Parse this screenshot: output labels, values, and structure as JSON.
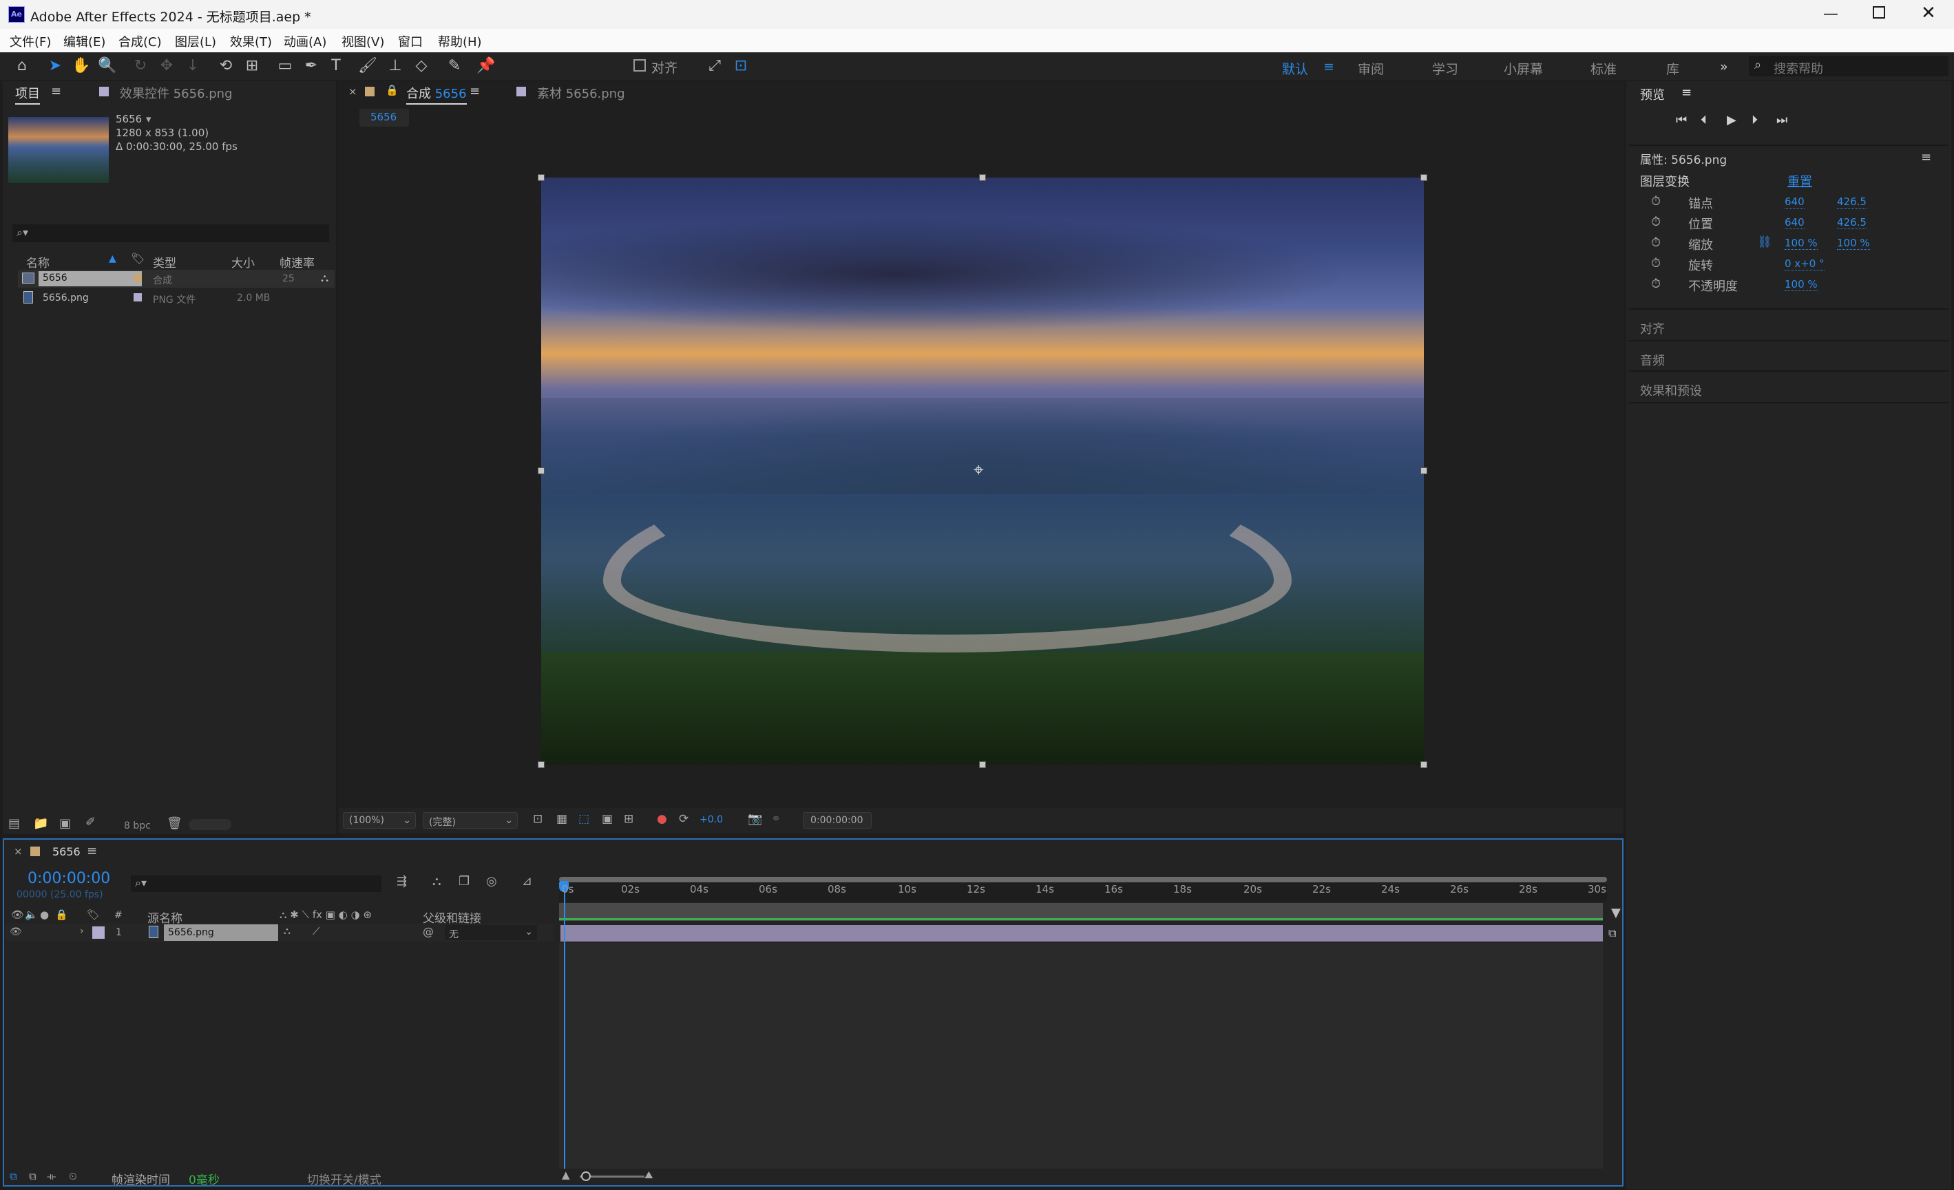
{
  "window": {
    "title": "Adobe After Effects 2024 - 无标题项目.aep *",
    "app_icon": "Ae"
  },
  "menu": [
    "文件(F)",
    "编辑(E)",
    "合成(C)",
    "图层(L)",
    "效果(T)",
    "动画(A)",
    "视图(V)",
    "窗口",
    "帮助(H)"
  ],
  "toolbar": {
    "align_label": "对齐",
    "workspaces": [
      "默认",
      "审阅",
      "学习",
      "小屏幕",
      "标准",
      "库"
    ],
    "search_placeholder": "搜索帮助"
  },
  "project": {
    "tab_label": "项目",
    "effects_tab": "效果控件 5656.png",
    "comp_name": "5656",
    "comp_size": "1280 x 853 (1.00)",
    "comp_duration": "Δ 0:00:30:00, 25.00 fps",
    "columns": [
      "名称",
      "类型",
      "大小",
      "帧速率"
    ],
    "items": [
      {
        "name": "5656",
        "type": "合成",
        "size": "",
        "fps": "25"
      },
      {
        "name": "5656.png",
        "type": "PNG 文件",
        "size": "2.0 MB",
        "fps": ""
      }
    ],
    "bpc": "8 bpc"
  },
  "comp_panel": {
    "tab_prefix": "合成",
    "tab_name": "5656",
    "footage_tab": "素材 5656.png",
    "breadcrumb": "5656",
    "zoom": "(100%)",
    "quality": "(完整)",
    "exposure": "+0.0",
    "timecode": "0:00:00:00"
  },
  "preview": {
    "title": "预览"
  },
  "properties": {
    "title": "属性: 5656.png",
    "section": "图层变换",
    "reset": "重置",
    "rows": [
      {
        "label": "锚点",
        "v1": "640",
        "v2": "426.5"
      },
      {
        "label": "位置",
        "v1": "640",
        "v2": "426.5"
      },
      {
        "label": "缩放",
        "v1": "100 %",
        "v2": "100 %"
      },
      {
        "label": "旋转",
        "v1": "0 x+0 °",
        "v2": ""
      },
      {
        "label": "不透明度",
        "v1": "100 %",
        "v2": ""
      }
    ],
    "panels": [
      "对齐",
      "音频",
      "效果和预设"
    ]
  },
  "timeline": {
    "tab_name": "5656",
    "timecode": "0:00:00:00",
    "frames": "00000 (25.00 fps)",
    "col_source": "源名称",
    "col_parent": "父级和链接",
    "layer": {
      "num": "1",
      "name": "5656.png",
      "parent": "无"
    },
    "ruler": [
      "0s",
      "02s",
      "04s",
      "06s",
      "08s",
      "10s",
      "12s",
      "14s",
      "16s",
      "18s",
      "20s",
      "22s",
      "24s",
      "26s",
      "28s",
      "30s"
    ],
    "render_label": "帧渲染时间",
    "render_value": "0毫秒",
    "toggle_label": "切换开关/模式"
  },
  "colors": {
    "accent": "#2d8ceb",
    "layer_bar": "#8f86a8",
    "work_area": "#37b24d"
  }
}
